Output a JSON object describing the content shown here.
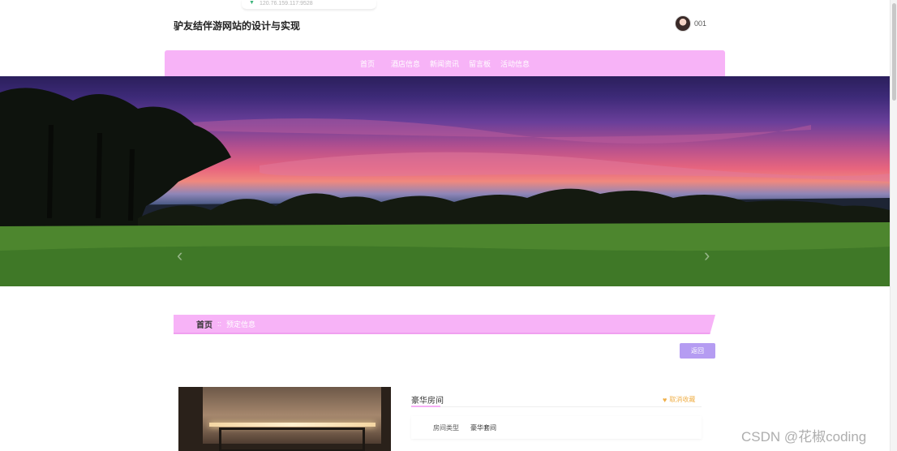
{
  "ip_hint": "120.76.159.117:9528",
  "header": {
    "site_title": "驴友结伴游网站的设计与实现",
    "username": "001"
  },
  "nav": {
    "items": [
      "首页",
      "酒店信息",
      "新闻资讯",
      "留言板",
      "活动信息"
    ]
  },
  "banner": {
    "prev_arrow": "‹",
    "next_arrow": "›"
  },
  "breadcrumb": {
    "home": "首页",
    "separator": "::",
    "current": "预定信息"
  },
  "back_button": "返回",
  "detail": {
    "room_name": "豪华房间",
    "favorite_label": "取消收藏",
    "info": [
      {
        "label": "房间类型",
        "value": "豪华套间"
      }
    ]
  },
  "watermark": "CSDN @花椒coding",
  "colors": {
    "nav_bg": "#f7b3f7",
    "button_bg": "#b59cf2",
    "favorite": "#f0b04a"
  }
}
